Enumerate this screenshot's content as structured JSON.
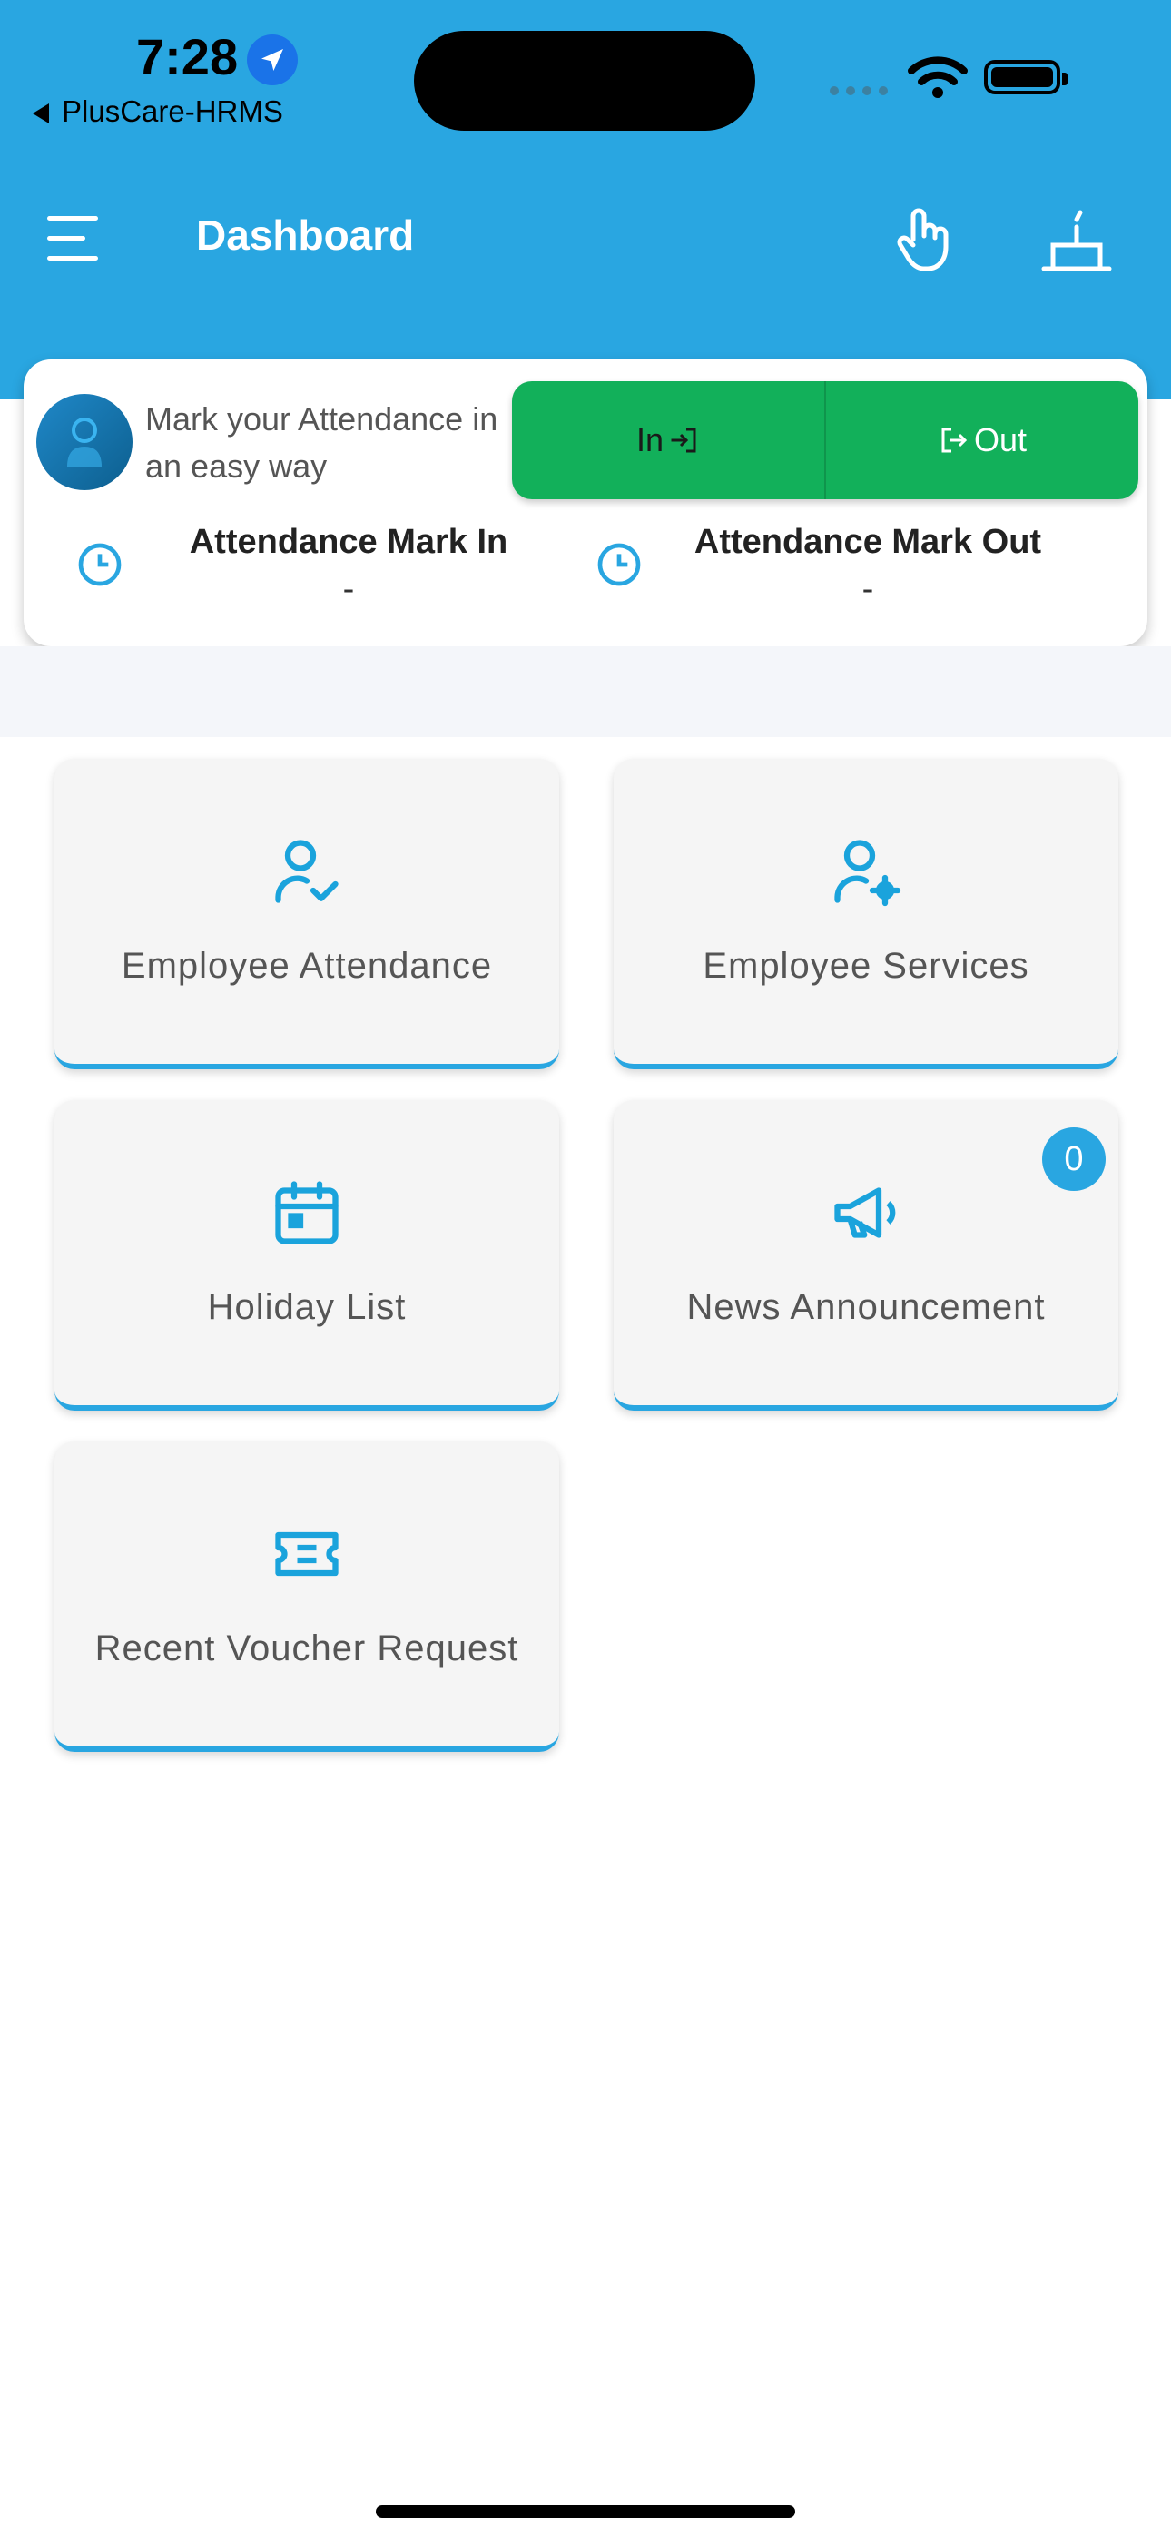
{
  "status_bar": {
    "time": "7:28",
    "back_app": "PlusCare-HRMS"
  },
  "app_bar": {
    "title": "Dashboard"
  },
  "attendance": {
    "prompt": "Mark your Attendance in an easy way",
    "in_label": "In",
    "out_label": "Out",
    "mark_in_label": "Attendance Mark In",
    "mark_in_value": "-",
    "mark_out_label": "Attendance Mark Out",
    "mark_out_value": "-"
  },
  "tiles": [
    {
      "label": "Employee Attendance",
      "icon": "user-check-icon"
    },
    {
      "label": "Employee Services",
      "icon": "user-gear-icon"
    },
    {
      "label": "Holiday List",
      "icon": "calendar-icon"
    },
    {
      "label": "News Announcement",
      "icon": "megaphone-icon",
      "badge": "0"
    },
    {
      "label": "Recent Voucher Request",
      "icon": "ticket-icon"
    }
  ],
  "colors": {
    "primary": "#29a6e1",
    "accent_green": "#12b05a",
    "tile_bg": "#f5f5f5"
  }
}
